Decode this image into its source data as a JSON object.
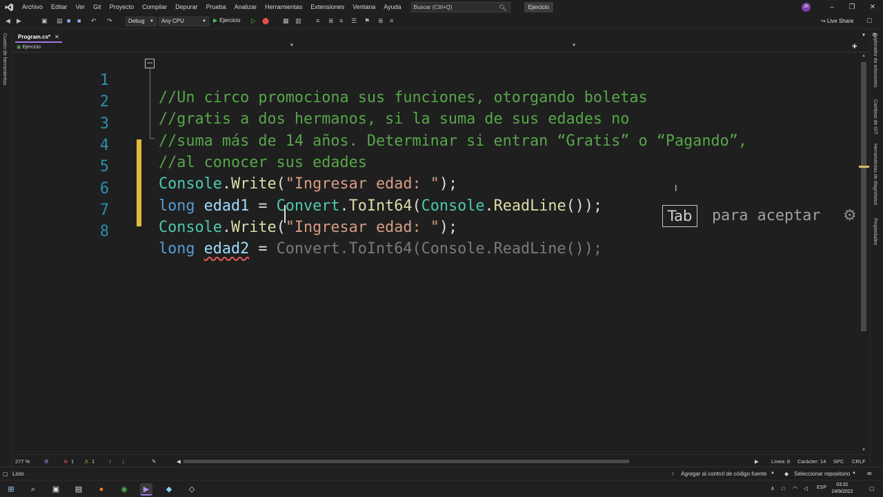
{
  "menubar": {
    "items": [
      "Archivo",
      "Editar",
      "Ver",
      "Git",
      "Proyecto",
      "Compilar",
      "Depurar",
      "Prueba",
      "Analizar",
      "Herramientas",
      "Extensiones",
      "Ventana",
      "Ayuda"
    ],
    "search_placeholder": "Buscar (Ctrl+Q)",
    "solution_name": "Ejercicio",
    "avatar_initials": "JR"
  },
  "toolbar": {
    "config": "Debug",
    "platform": "Any CPU",
    "run_target": "Ejercicio",
    "live_share": "Live Share"
  },
  "left_strip": {
    "label": "Cuadro de herramientas"
  },
  "right_strip": {
    "labels": [
      "Explorador de soluciones",
      "Cambios de GIT",
      "Herramientas de diagnóstico",
      "Propiedades"
    ]
  },
  "document": {
    "tab_label": "Program.cs*",
    "nav_project": "Ejercicio"
  },
  "editor": {
    "line_numbers": [
      "1",
      "2",
      "3",
      "4",
      "5",
      "6",
      "7",
      "8"
    ],
    "lines": [
      "//Un circo promociona sus funciones, otorgando boletas",
      "//gratis a dos hermanos, si la suma de sus edades no",
      "//suma más de 14 años. Determinar si entran “Gratis” o “Pagando”,",
      "//al conocer sus edades"
    ],
    "code5": {
      "cls": "Console",
      "dot": ".",
      "method": "Write",
      "open": "(",
      "str": "\"Ingresar edad: \"",
      "close": ");"
    },
    "code6": {
      "kw": "long",
      "var": "edad1",
      "eq": " = ",
      "cls": "Convert",
      "dot": ".",
      "method": "ToInt64",
      "open": "(",
      "cls2": "Console",
      "dot2": ".",
      "method2": "ReadLine",
      "close": "());"
    },
    "code7": {
      "cls": "Console",
      "dot": ".",
      "method": "Write",
      "open": "(",
      "str": "\"Ingresar edad: \"",
      "close": ");"
    },
    "code8": {
      "kw": "long",
      "var": "edad2",
      "eq": " = ",
      "ghost": "Convert.ToInt64(Console.ReadLine());"
    },
    "tab_key": "Tab",
    "accept_text": "para aceptar"
  },
  "editor_status": {
    "zoom": "277 %",
    "errors": "1",
    "warnings": "1",
    "line": "Línea: 8",
    "char": "Carácter: 14",
    "spc": "SPC",
    "crlf": "CRLF"
  },
  "statusbar": {
    "ready": "Listo",
    "source_control": "Agregar al control de código fuente",
    "select_repo": "Seleccionar repositorio"
  },
  "taskbar": {
    "lang": "ESP",
    "time": "03:31",
    "date": "24/9/2022"
  },
  "colors": {
    "accent": "#9f79e6",
    "comment": "#57a64a",
    "keyword": "#569cd6",
    "class": "#4ec9b0",
    "method": "#dcdcaa",
    "string": "#d69d85",
    "line_number": "#2b91af",
    "changed_bar": "#e2b93b"
  }
}
